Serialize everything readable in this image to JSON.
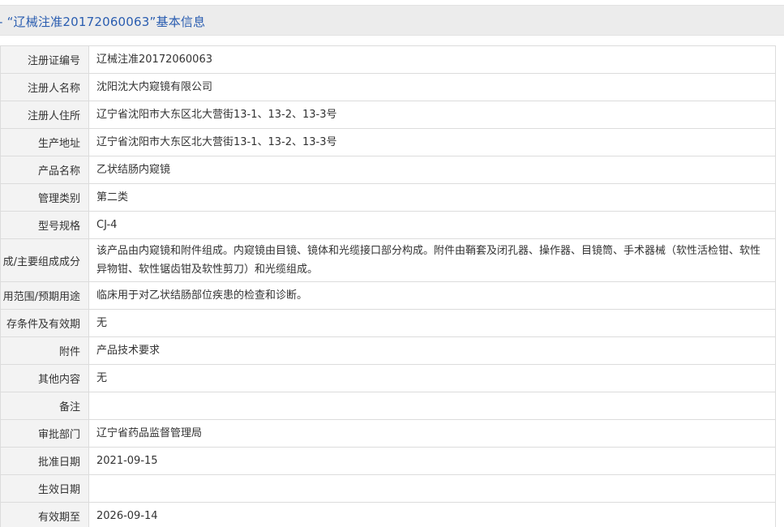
{
  "header": {
    "title": "- “辽械注准20172060063”基本信息"
  },
  "rows": [
    {
      "label": "注册证编号",
      "value": "辽械注准20172060063"
    },
    {
      "label": "注册人名称",
      "value": "沈阳沈大内窥镜有限公司"
    },
    {
      "label": "注册人住所",
      "value": "辽宁省沈阳市大东区北大营街13-1、13-2、13-3号"
    },
    {
      "label": "生产地址",
      "value": "辽宁省沈阳市大东区北大营街13-1、13-2、13-3号"
    },
    {
      "label": "产品名称",
      "value": "乙状结肠内窥镜"
    },
    {
      "label": "管理类别",
      "value": "第二类"
    },
    {
      "label": "型号规格",
      "value": "CJ-4"
    },
    {
      "label": "成/主要组成成分",
      "value": "该产品由内窥镜和附件组成。内窥镜由目镜、镜体和光缆接口部分构成。附件由鞘套及闭孔器、操作器、目镜筒、手术器械（软性活检钳、软性异物钳、软性锯齿钳及软性剪刀）和光缆组成。"
    },
    {
      "label": "用范围/预期用途",
      "value": "临床用于对乙状结肠部位疾患的检查和诊断。"
    },
    {
      "label": "存条件及有效期",
      "value": "无"
    },
    {
      "label": "附件",
      "value": "产品技术要求"
    },
    {
      "label": "其他内容",
      "value": "无"
    },
    {
      "label": "备注",
      "value": ""
    },
    {
      "label": "审批部门",
      "value": "辽宁省药品监督管理局"
    },
    {
      "label": "批准日期",
      "value": "2021-09-15"
    },
    {
      "label": "生效日期",
      "value": ""
    },
    {
      "label": "有效期至",
      "value": "2026-09-14"
    }
  ]
}
